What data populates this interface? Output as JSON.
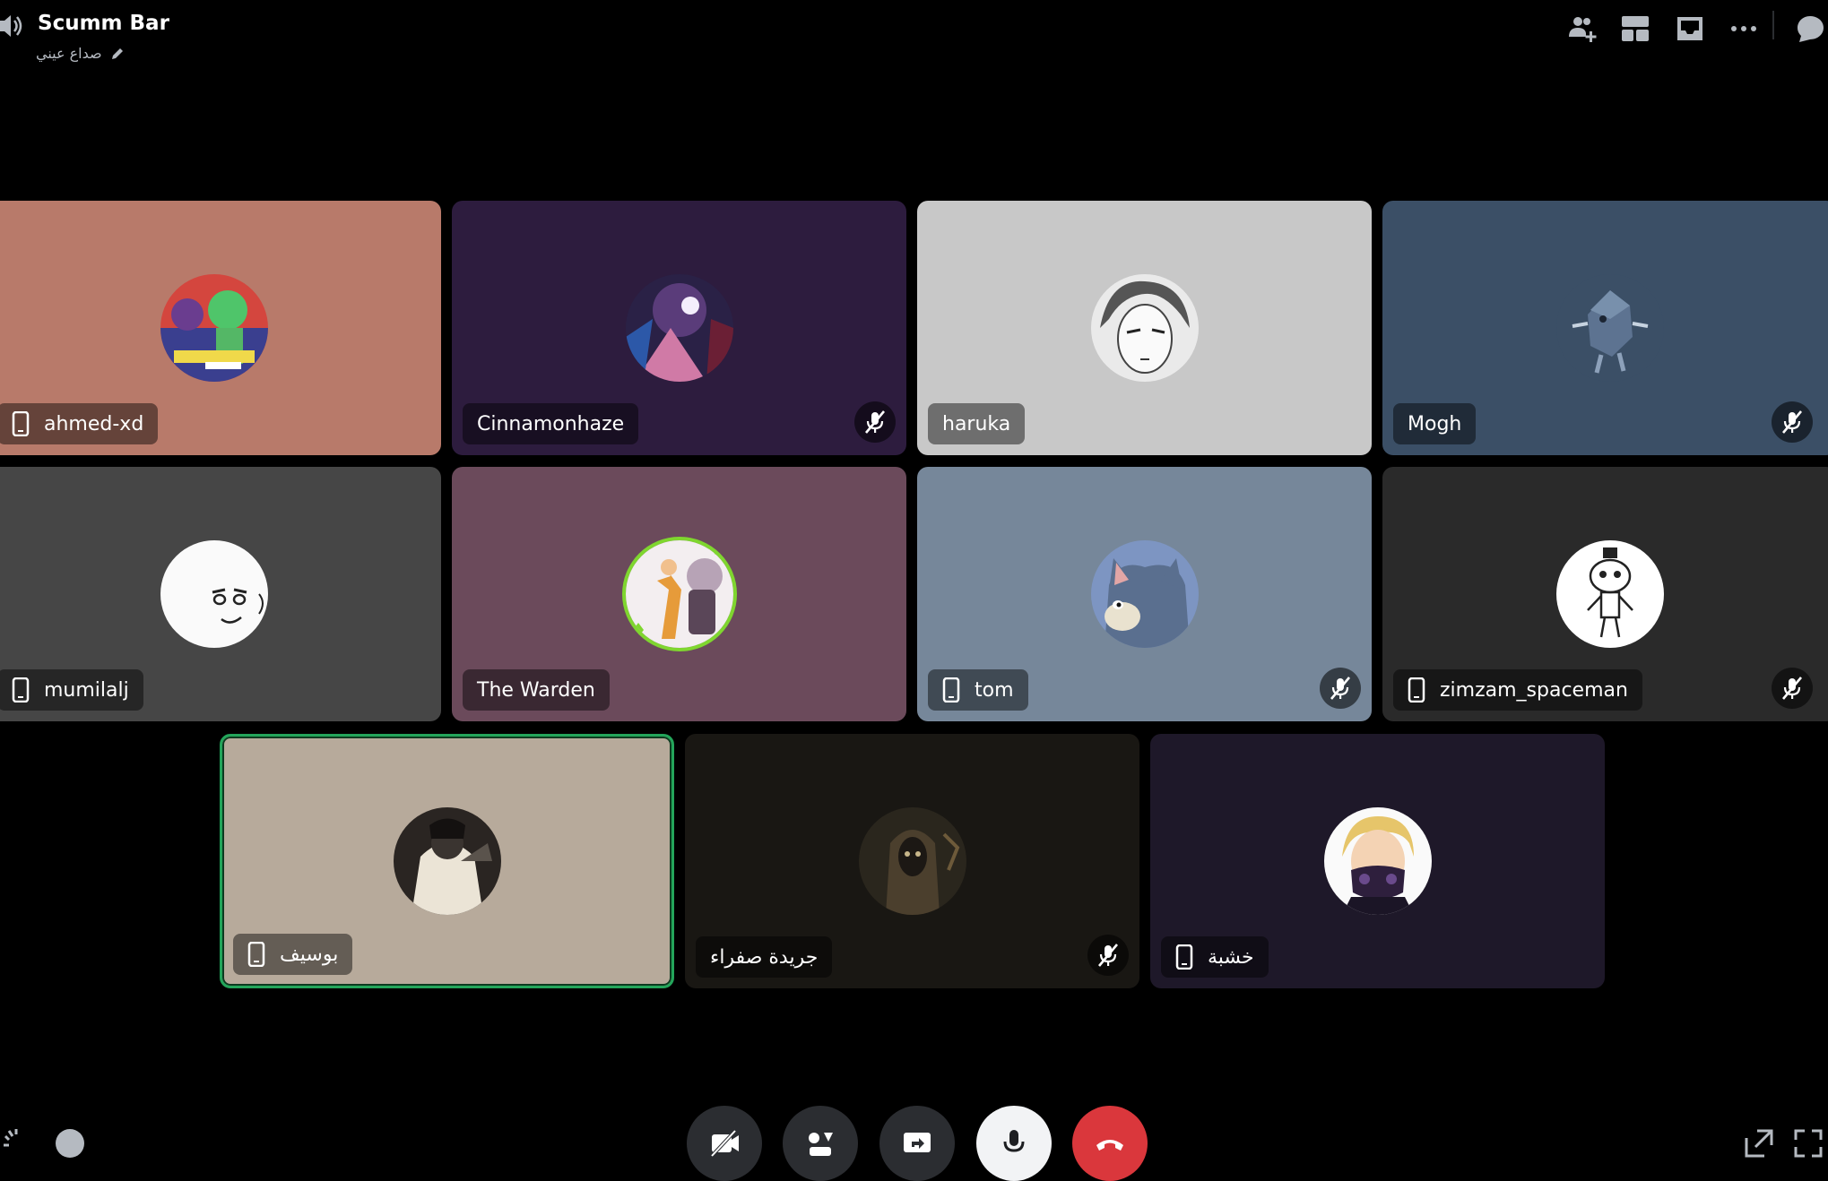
{
  "header": {
    "channel_name": "Scumm Bar",
    "status_text": "صداع عيني",
    "icons": [
      "speaker-icon",
      "edit-status-icon",
      "invite-icon",
      "layout-icon",
      "inbox-icon",
      "more-icon",
      "chat-icon"
    ]
  },
  "participants": [
    {
      "name": "ahmed-xd",
      "mobile": true,
      "muted": false,
      "bg": "#b87a6a"
    },
    {
      "name": "Cinnamonhaze",
      "mobile": false,
      "muted": true,
      "bg": "#2d1c3e"
    },
    {
      "name": "haruka",
      "mobile": false,
      "muted": false,
      "bg": "#c8c8c8"
    },
    {
      "name": "Mogh",
      "mobile": false,
      "muted": true,
      "bg": "#3b4f66"
    },
    {
      "name": "mumilalj",
      "mobile": true,
      "muted": false,
      "bg": "#464646"
    },
    {
      "name": "The Warden",
      "mobile": false,
      "muted": false,
      "bg": "#6b4a5b"
    },
    {
      "name": "tom",
      "mobile": true,
      "muted": true,
      "bg": "#76879a"
    },
    {
      "name": "zimzam_spaceman",
      "mobile": true,
      "muted": true,
      "bg": "#2a2a2a"
    },
    {
      "name": "بوسيف",
      "mobile": true,
      "muted": false,
      "speaking": true,
      "bg": "#b7aa9b"
    },
    {
      "name": "جريدة صفراء",
      "mobile": false,
      "muted": true,
      "bg": "#191713"
    },
    {
      "name": "خشبة",
      "mobile": true,
      "muted": false,
      "bg": "#1e1829"
    }
  ],
  "controls": [
    "camera-off-button",
    "activities-button",
    "share-screen-button",
    "microphone-button",
    "disconnect-button"
  ],
  "colors": {
    "speaking": "#23a55a",
    "disconnect": "#da373c",
    "control_bg": "#2b2d31"
  }
}
